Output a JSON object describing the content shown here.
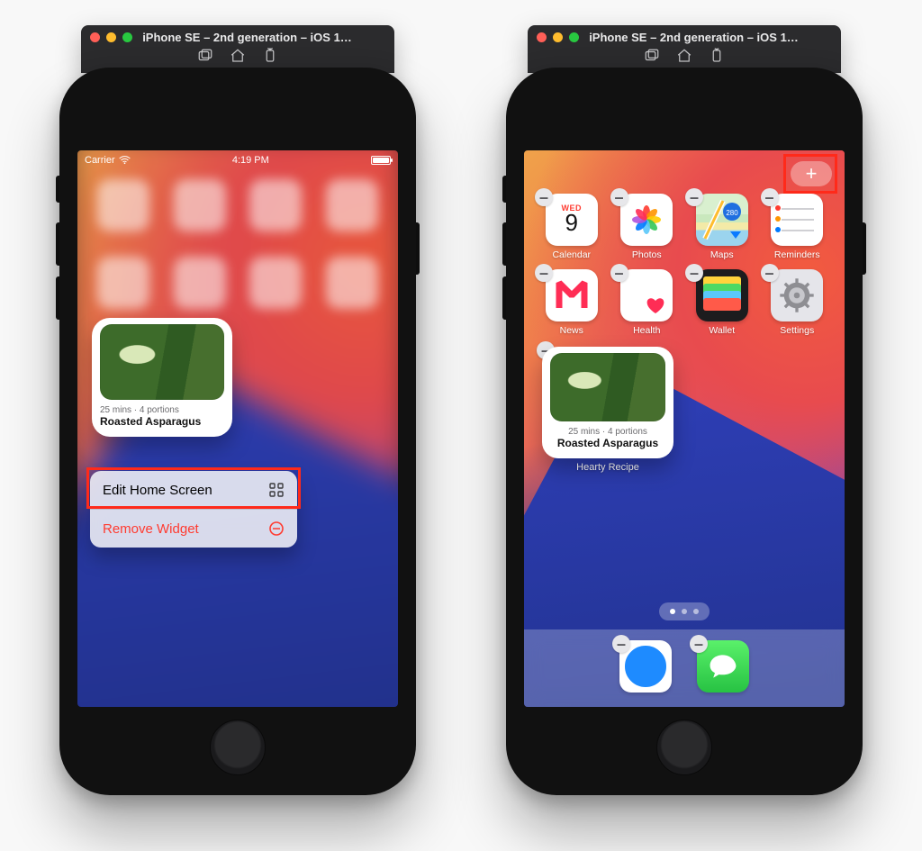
{
  "simulator": {
    "title": "iPhone SE – 2nd generation – iOS 1…"
  },
  "status": {
    "carrier": "Carrier",
    "time": "4:19 PM"
  },
  "widget": {
    "subtitle": "25 mins · 4 portions",
    "title": "Roasted Asparagus",
    "caption": "Hearty Recipe"
  },
  "contextMenu": {
    "edit": "Edit Home Screen",
    "remove": "Remove Widget"
  },
  "calendar": {
    "dow": "WED",
    "day": "9"
  },
  "apps": {
    "row1": [
      "Calendar",
      "Photos",
      "Maps",
      "Reminders"
    ],
    "row2": [
      "News",
      "Health",
      "Wallet",
      "Settings"
    ]
  },
  "dock": [
    "Safari",
    "Messages"
  ]
}
